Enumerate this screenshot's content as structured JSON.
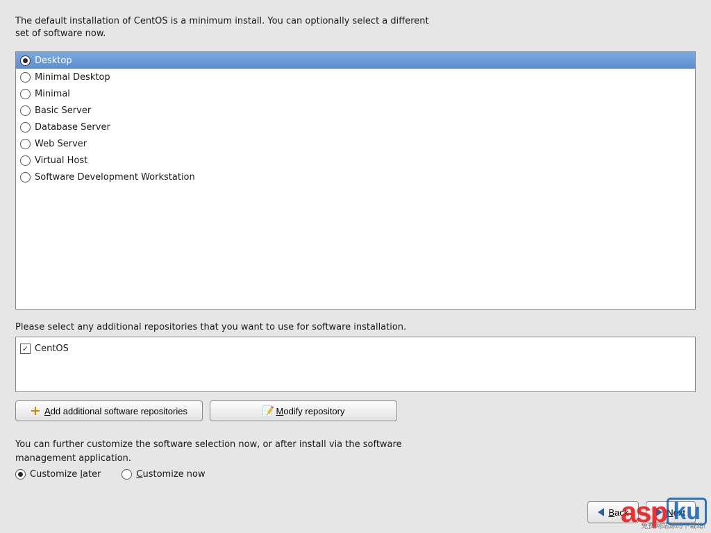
{
  "intro": "The default installation of CentOS is a minimum install. You can optionally select a different set of software now.",
  "software_options": [
    {
      "label": "Desktop",
      "selected": true
    },
    {
      "label": "Minimal Desktop",
      "selected": false
    },
    {
      "label": "Minimal",
      "selected": false
    },
    {
      "label": "Basic Server",
      "selected": false
    },
    {
      "label": "Database Server",
      "selected": false
    },
    {
      "label": "Web Server",
      "selected": false
    },
    {
      "label": "Virtual Host",
      "selected": false
    },
    {
      "label": "Software Development Workstation",
      "selected": false
    }
  ],
  "repo_prompt": "Please select any additional repositories that you want to use for software installation.",
  "repositories": [
    {
      "label": "CentOS",
      "checked": true
    }
  ],
  "buttons": {
    "add_repo": "Add additional software repositories",
    "add_repo_accel": "A",
    "modify_repo": "Modify repository",
    "modify_repo_accel": "M"
  },
  "customize_text": "You can further customize the software selection now, or after install via the software management application.",
  "customize": {
    "later": "Customize later",
    "later_accel": "l",
    "now": "Customize now",
    "now_accel": "C",
    "selected": "later"
  },
  "nav": {
    "back": "Back",
    "back_accel": "B",
    "next": "Next",
    "next_accel": "N"
  },
  "watermark": {
    "brand": "aspku",
    "sub": "免费网站源码下载站!",
    "dotcom": ".com"
  }
}
